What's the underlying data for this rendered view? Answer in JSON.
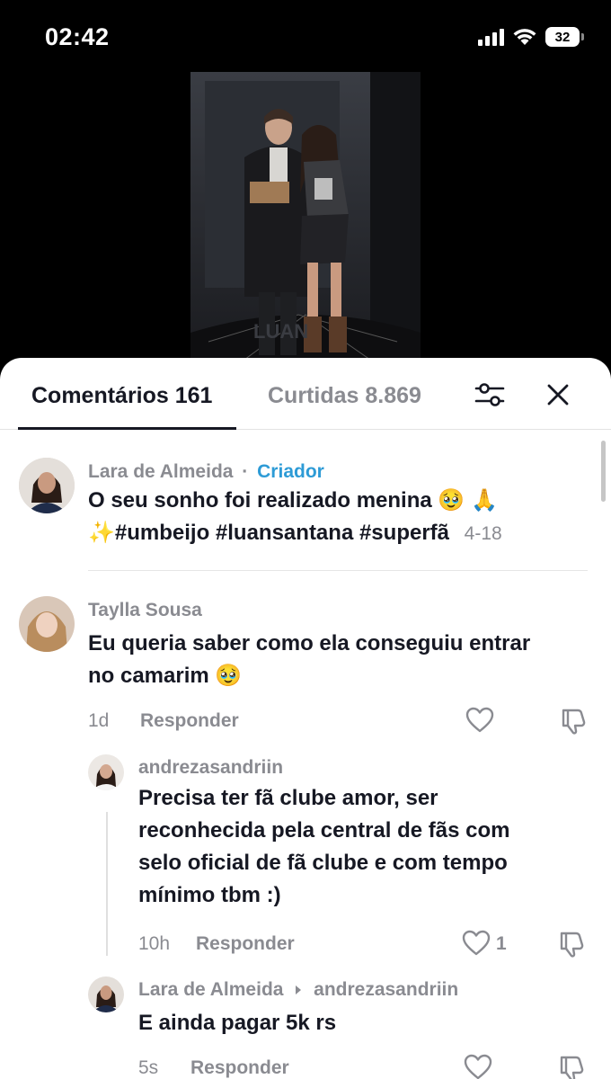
{
  "status_bar": {
    "time": "02:42",
    "battery": "32",
    "icons": [
      "cellular-signal-icon",
      "wifi-icon",
      "battery-icon"
    ]
  },
  "tabs": {
    "comments": "Comentários 161",
    "likes": "Curtidas 8.869",
    "filter_icon": "filter-sliders-icon",
    "close_icon": "close-icon"
  },
  "comments": [
    {
      "username": "Lara de Almeida",
      "separator": "·",
      "badge": "Criador",
      "text_line1": "O seu sonho foi realizado menina 🥹 🙏",
      "text_line2": "✨#umbeijo #luansantana #superfã",
      "date": "4-18"
    },
    {
      "username": "Taylla Sousa",
      "text_line1": "Eu queria saber como ela conseguiu entrar",
      "text_line2": "no camarim 🥹",
      "date": "1d",
      "reply_label": "Responder"
    }
  ],
  "replies": [
    {
      "username": "andrezasandriin",
      "text_lines": [
        "Precisa ter fã clube amor, ser",
        "reconhecida pela central de fãs com",
        "selo oficial de fã clube e com tempo",
        "mínimo tbm :)"
      ],
      "date": "10h",
      "reply_label": "Responder",
      "likes": "1"
    },
    {
      "username": "Lara de Almeida",
      "reply_to": "andrezasandriin",
      "text": "E ainda pagar 5k rs",
      "date": "5s",
      "reply_label": "Responder"
    }
  ],
  "colors": {
    "accent_creator": "#2d9bd6",
    "text_primary": "#161823",
    "text_secondary": "#8a8b91"
  }
}
